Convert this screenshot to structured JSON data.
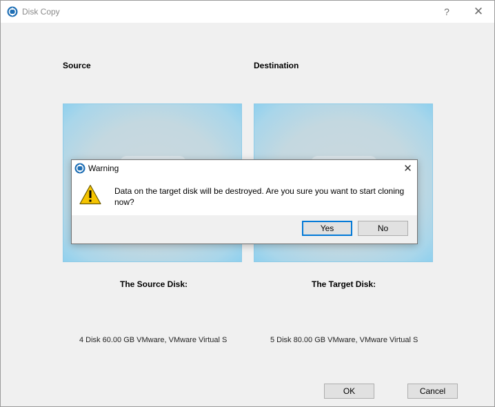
{
  "window": {
    "title": "Disk Copy",
    "help_glyph": "?",
    "close_glyph": "✕"
  },
  "source": {
    "heading": "Source",
    "disk_label": "The Source Disk:",
    "disk_info": "4 Disk 60.00 GB VMware,  VMware Virtual S"
  },
  "destination": {
    "heading": "Destination",
    "disk_label": "The Target Disk:",
    "disk_info": "5 Disk 80.00 GB VMware,  VMware Virtual S"
  },
  "footer": {
    "ok_label": "OK",
    "cancel_label": "Cancel"
  },
  "dialog": {
    "title": "Warning",
    "close_glyph": "✕",
    "message": "Data on the target disk will be destroyed. Are you sure you want to start cloning now?",
    "yes_label": "Yes",
    "no_label": "No"
  },
  "colors": {
    "accent": "#0078d7",
    "disk_box_edge": "#8fd0ee",
    "warning_yellow": "#f5c400"
  },
  "icons": {
    "app": "minitool-logo-icon",
    "warning": "warning-triangle-icon"
  }
}
